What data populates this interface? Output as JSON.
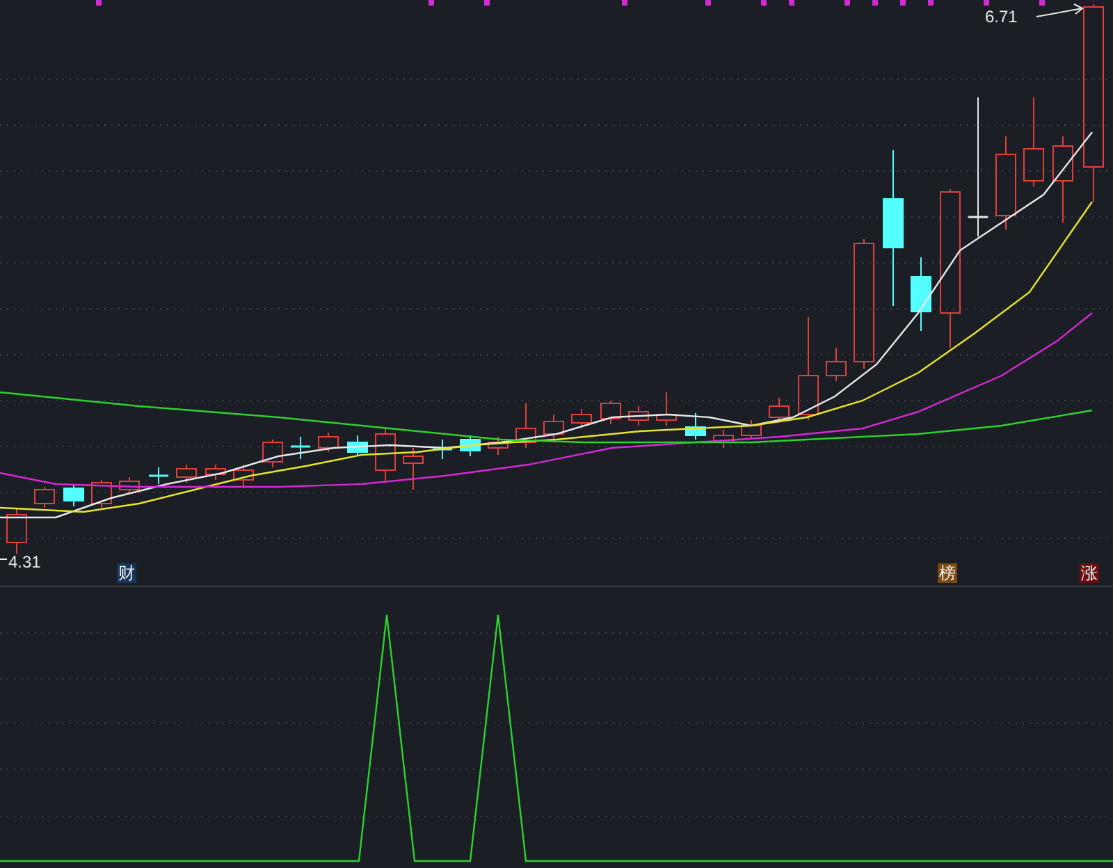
{
  "price_chart": {
    "high_label": "6.71",
    "low_label": "4.31",
    "markers": [
      {
        "text": "财",
        "color": "#14365a"
      },
      {
        "text": "榜",
        "color": "#7a4a12"
      },
      {
        "text": "涨",
        "color": "#6a0c10"
      }
    ]
  }
}
